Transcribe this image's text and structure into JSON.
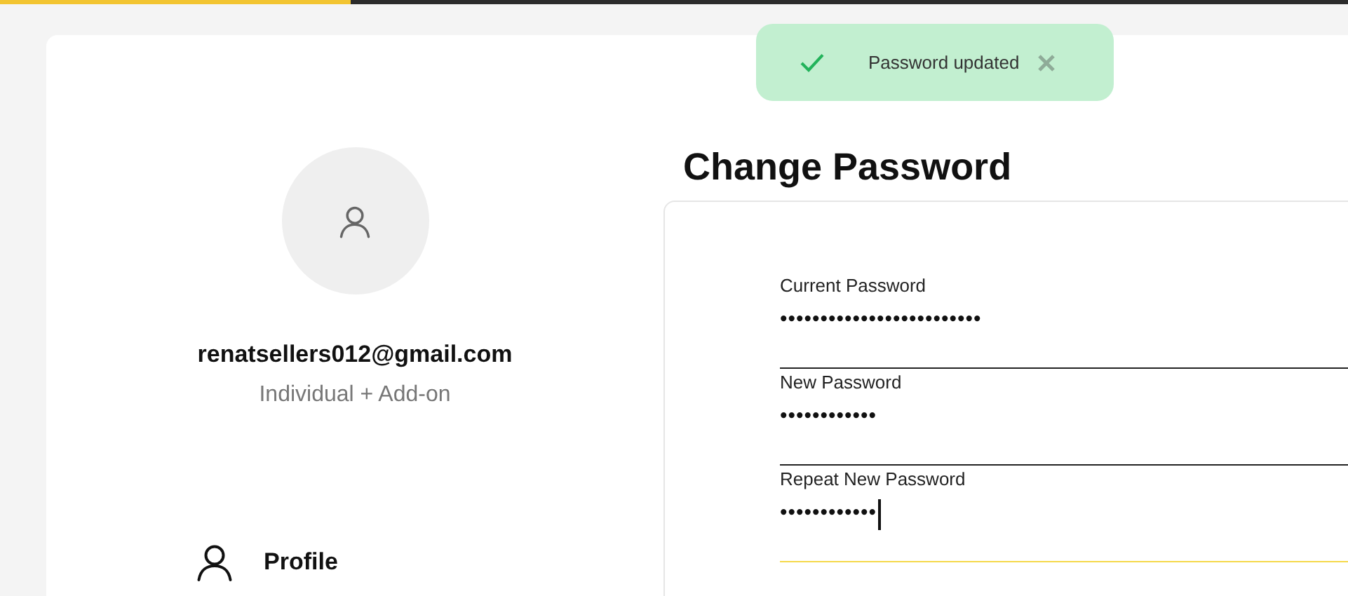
{
  "progress": {
    "level": 0.26
  },
  "toast": {
    "message": "Password updated"
  },
  "profile": {
    "email": "renatsellers012@gmail.com",
    "plan": "Individual + Add-on"
  },
  "nav": [
    {
      "label": "Profile"
    }
  ],
  "heading": "Change Password",
  "fields": [
    {
      "label": "Current Password",
      "value": "•••••••••••••••••••••••••",
      "focused": false
    },
    {
      "label": "New Password",
      "value": "••••••••••••",
      "focused": false
    },
    {
      "label": "Repeat New Password",
      "value": "••••••••••••",
      "focused": true
    }
  ]
}
